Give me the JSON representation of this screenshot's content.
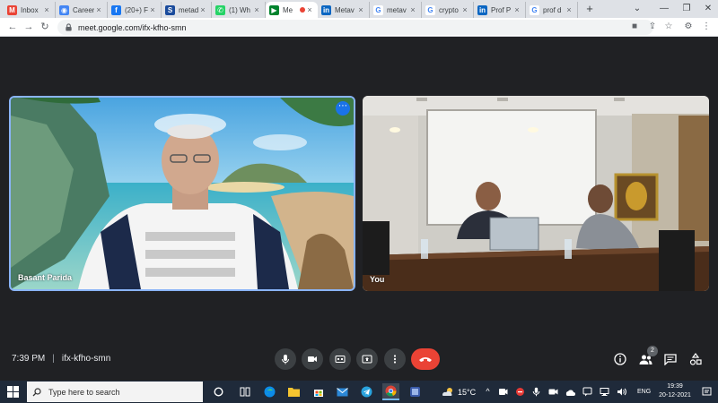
{
  "browser": {
    "tabs": [
      {
        "title": "Inbox",
        "favicon": "gmail-icon",
        "color": "#ea4335"
      },
      {
        "title": "Career",
        "favicon": "globe-icon",
        "color": "#4285f4"
      },
      {
        "title": "(20+) F",
        "favicon": "facebook-icon",
        "color": "#1877f2"
      },
      {
        "title": "metad",
        "favicon": "s-logo-icon",
        "color": "#1a4b9c"
      },
      {
        "title": "(1) Wh",
        "favicon": "whatsapp-icon",
        "color": "#25d366"
      },
      {
        "title": "Me",
        "favicon": "meet-icon",
        "color": "#00832d",
        "active": true,
        "recording": true
      },
      {
        "title": "Metav",
        "favicon": "linkedin-icon",
        "color": "#0a66c2"
      },
      {
        "title": "metav",
        "favicon": "google-icon",
        "color": "#4285f4"
      },
      {
        "title": "crypto",
        "favicon": "google-icon",
        "color": "#4285f4"
      },
      {
        "title": "Prof P",
        "favicon": "linkedin-icon",
        "color": "#0a66c2"
      },
      {
        "title": "prof d",
        "favicon": "google-icon",
        "color": "#4285f4"
      }
    ],
    "new_tab_label": "+",
    "url": "meet.google.com/ifx-kfho-smn"
  },
  "meet": {
    "participants": [
      {
        "name": "Basant Parida",
        "active_speaker": true
      },
      {
        "name": "You",
        "active_speaker": false
      }
    ],
    "time": "7:39 PM",
    "separator": "|",
    "meeting_code": "ifx-kfho-smn",
    "participant_count": "2",
    "colors": {
      "hangup": "#ea4335",
      "highlight": "#8ab4f8",
      "control": "#3c4043"
    }
  },
  "taskbar": {
    "search_placeholder": "Type here to search",
    "temperature": "15°C",
    "language": "ENG",
    "clock_time": "19:39",
    "clock_date": "20-12-2021"
  }
}
